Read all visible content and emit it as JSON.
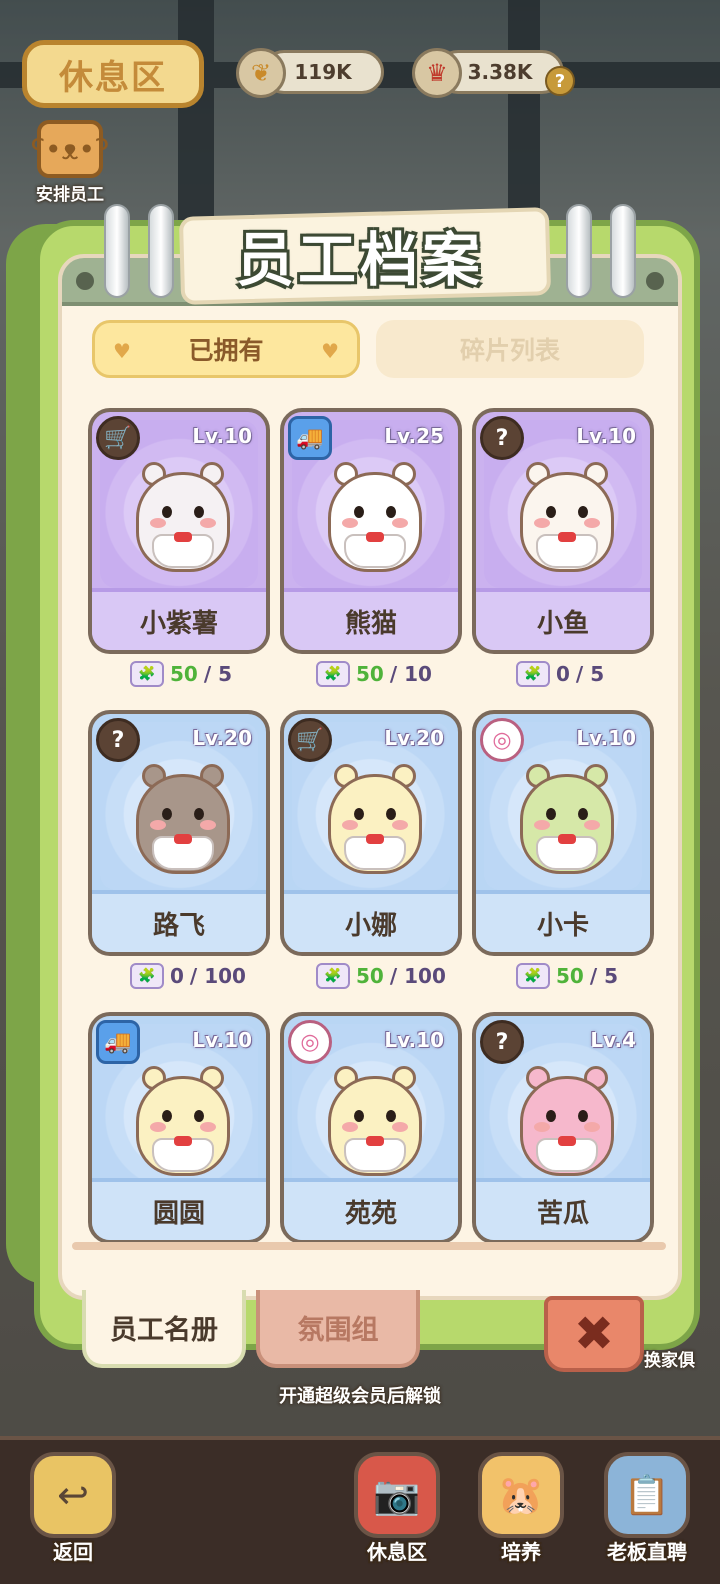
{
  "hud": {
    "area_button": "休息区",
    "resource_1": {
      "value": "119K",
      "icon": "grain-icon"
    },
    "resource_2": {
      "value": "3.38K",
      "icon": "crown-icon"
    },
    "help": "?",
    "assign_label": "安排员工"
  },
  "panel": {
    "title": "员工档案",
    "tabs": {
      "owned": "已拥有",
      "shards": "碎片列表"
    }
  },
  "cards": [
    {
      "name": "小紫薯",
      "level": "Lv.10",
      "theme": "purple",
      "badge": "cart",
      "badge_glyph": "🛒",
      "fur": "#f5f1f3",
      "shards_have": "50",
      "shards_need": "/ 5"
    },
    {
      "name": "熊猫",
      "level": "Lv.25",
      "theme": "purple",
      "badge": "truck",
      "badge_glyph": "🚚",
      "fur": "#ffffff",
      "shards_have": "50",
      "shards_need": "/ 10"
    },
    {
      "name": "小鱼",
      "level": "Lv.10",
      "theme": "purple",
      "badge": "question",
      "badge_glyph": "?",
      "fur": "#fbf5ee",
      "shards_have": "0",
      "shards_need": "/ 5"
    },
    {
      "name": "路飞",
      "level": "Lv.20",
      "theme": "blue",
      "badge": "question",
      "badge_glyph": "?",
      "fur": "#a8968a",
      "shards_have": "0",
      "shards_need": "/ 100"
    },
    {
      "name": "小娜",
      "level": "Lv.20",
      "theme": "blue",
      "badge": "cart",
      "badge_glyph": "🛒",
      "fur": "#fbf1c2",
      "shards_have": "50",
      "shards_need": "/ 100"
    },
    {
      "name": "小卡",
      "level": "Lv.10",
      "theme": "blue",
      "badge": "donut",
      "badge_glyph": "◎",
      "fur": "#d6e8a8",
      "shards_have": "50",
      "shards_need": "/ 5"
    },
    {
      "name": "圆圆",
      "level": "Lv.10",
      "theme": "blue",
      "badge": "truck",
      "badge_glyph": "🚚",
      "fur": "#fbf1c2",
      "shards_have": "",
      "shards_need": ""
    },
    {
      "name": "苑苑",
      "level": "Lv.10",
      "theme": "blue",
      "badge": "donut",
      "badge_glyph": "◎",
      "fur": "#fbf1c2",
      "shards_have": "",
      "shards_need": ""
    },
    {
      "name": "苦瓜",
      "level": "Lv.4",
      "theme": "blue",
      "badge": "question",
      "badge_glyph": "?",
      "fur": "#f6b8cc",
      "shards_have": "",
      "shards_need": ""
    }
  ],
  "book_tabs": {
    "roster": "员工名册",
    "atmosphere": "氛围组"
  },
  "close_glyph": "✖",
  "unlock_text": "开通超级会员后解锁",
  "swap_label": "换家俱",
  "nav": [
    {
      "label": "返回",
      "icon": "back-arrow-icon",
      "glyph": "↩",
      "color": "#e9c464"
    },
    {
      "label": "休息区",
      "icon": "camera-icon",
      "glyph": "📷",
      "color": "#d8584a"
    },
    {
      "label": "培养",
      "icon": "hamster-icon",
      "glyph": "🐹",
      "color": "#f2c26a"
    },
    {
      "label": "老板直聘",
      "icon": "clipboard-icon",
      "glyph": "📋",
      "color": "#8cb4d8"
    }
  ]
}
